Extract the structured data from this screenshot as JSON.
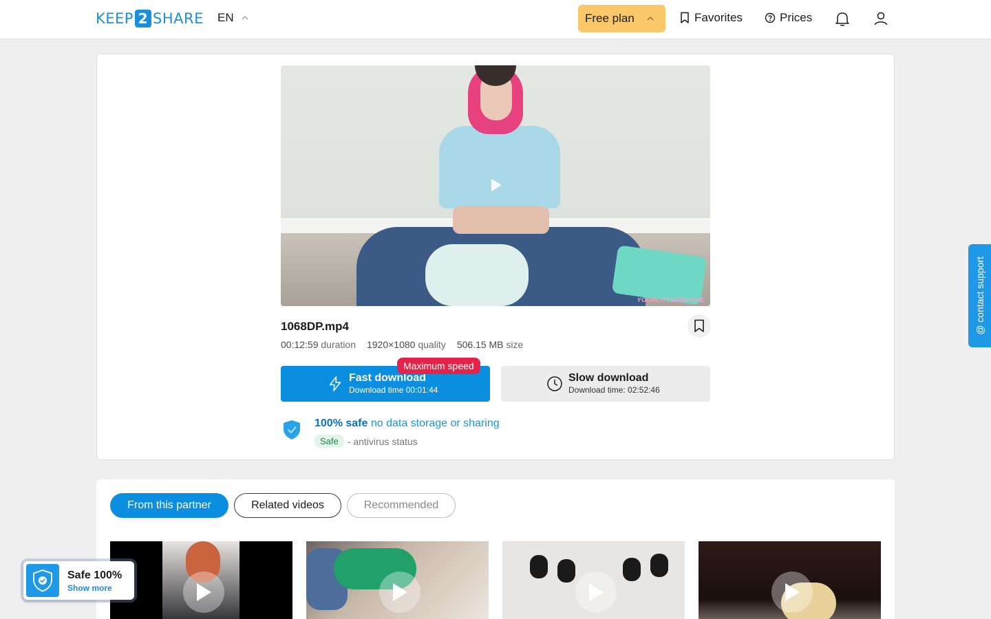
{
  "header": {
    "logo_left": "KEEP",
    "logo_mid": "2",
    "logo_right": "SHARE",
    "language": "EN",
    "plan_label": "Free plan",
    "favorites_label": "Favorites",
    "prices_label": "Prices",
    "plan_color": "#fbc86a"
  },
  "video": {
    "watermark": "YOURLITTLEWHORE"
  },
  "file": {
    "name": "1068DP.mp4",
    "duration_value": "00:12:59",
    "duration_label": "duration",
    "quality_value": "1920×1080",
    "quality_label": "quality",
    "size_value": "506.15 MB",
    "size_label": "size"
  },
  "download": {
    "badge": "Maximum speed",
    "fast_title": "Fast download",
    "fast_sub": "Download time 00:01:44",
    "slow_title": "Slow download",
    "slow_sub": "Download time: 02:52:46",
    "accent": "#0b8ee0",
    "badge_color": "#e3244a"
  },
  "safety": {
    "headline_bold": "100% safe",
    "headline_link": "no data storage or sharing",
    "badge": "Safe",
    "status_text": "- antivirus status"
  },
  "support": {
    "label": "contact support"
  },
  "tabs": {
    "partner": "From this partner",
    "related": "Related videos",
    "recommended": "Recommended"
  },
  "safe_float": {
    "title": "Safe 100%",
    "link": "Show more"
  },
  "icons": [
    "chevron-up-icon",
    "bookmark-icon",
    "question-circle-icon",
    "bell-icon",
    "user-icon",
    "play-icon",
    "lightning-icon",
    "clock-icon",
    "shield-check-icon"
  ]
}
